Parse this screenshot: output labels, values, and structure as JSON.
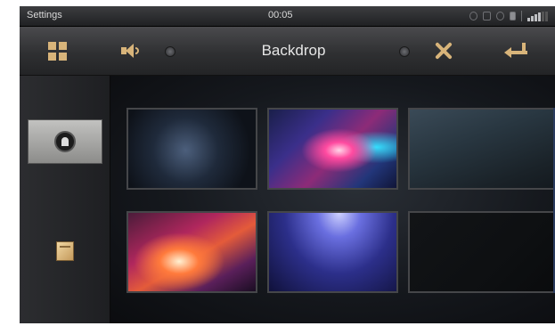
{
  "statusbar": {
    "title": "Settings",
    "time": "00:05",
    "icons": [
      "gps-icon",
      "sd-card-icon",
      "bluetooth-icon",
      "battery-icon",
      "network-label-icon",
      "signal-icon"
    ]
  },
  "toolbar": {
    "title": "Backdrop",
    "icons": [
      "grid-menu-icon",
      "volume-icon",
      "tools-icon",
      "return-icon"
    ],
    "accent_color": "#d8b47a"
  },
  "sidebar": {
    "items": [
      {
        "icon": "backdrop-icon",
        "selected": true
      },
      {
        "icon": "images-icon",
        "selected": false
      }
    ]
  },
  "wallpapers": [
    {
      "name": "dark-blue-glow",
      "selected": false
    },
    {
      "name": "magenta-cyan-burst",
      "selected": false
    },
    {
      "name": "teal-gradient",
      "selected": false
    },
    {
      "name": "orange-light-streaks",
      "selected": false
    },
    {
      "name": "purple-light-rays",
      "selected": false
    },
    {
      "name": "plain-black",
      "selected": false
    }
  ]
}
